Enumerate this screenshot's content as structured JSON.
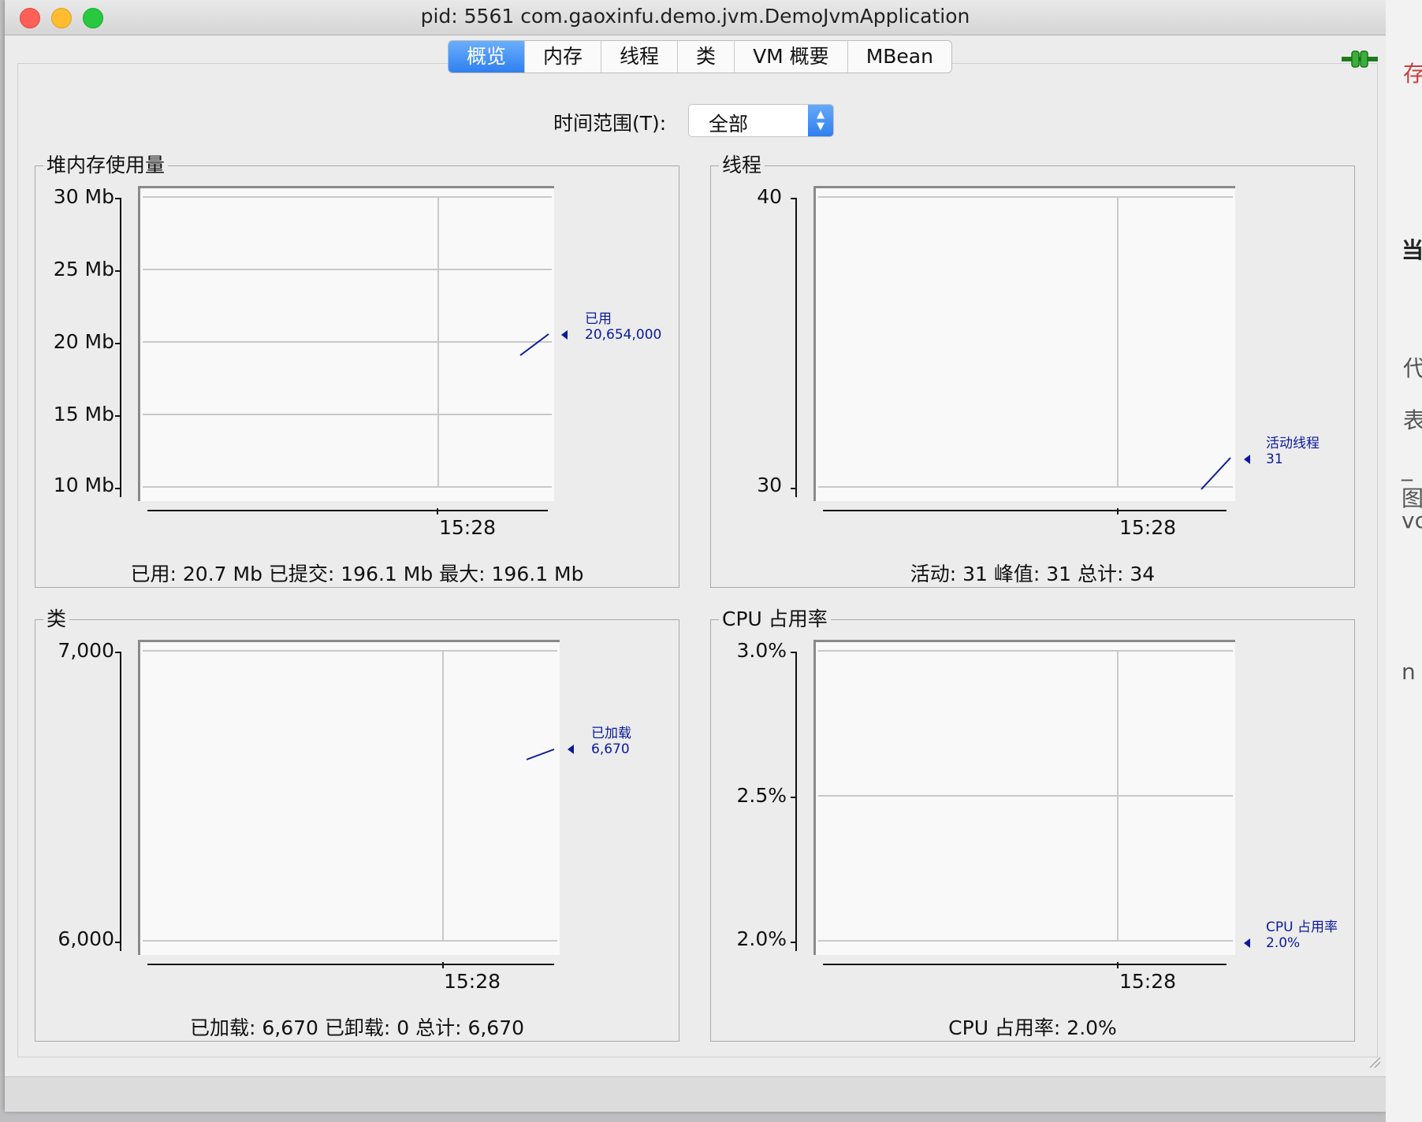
{
  "window": {
    "title": "pid: 5561 com.gaoxinfu.demo.jvm.DemoJvmApplication"
  },
  "tabs": [
    "概览",
    "内存",
    "线程",
    "类",
    "VM 概要",
    "MBean"
  ],
  "time_range": {
    "label": "时间范围(T):",
    "value": "全部"
  },
  "panels": {
    "heap": {
      "title": "堆内存使用量",
      "y_ticks": [
        "30 Mb",
        "25 Mb",
        "20 Mb",
        "15 Mb",
        "10 Mb"
      ],
      "x_label": "15:28",
      "legend_name": "已用",
      "legend_value": "20,654,000",
      "stats": "已用: 20.7 Mb    已提交: 196.1 Mb    最大: 196.1 Mb"
    },
    "threads": {
      "title": "线程",
      "y_ticks": [
        "40",
        "30"
      ],
      "x_label": "15:28",
      "legend_name": "活动线程",
      "legend_value": "31",
      "stats": "活动: 31    峰值: 31    总计: 34"
    },
    "classes": {
      "title": "类",
      "y_ticks": [
        "7,000",
        "6,000"
      ],
      "x_label": "15:28",
      "legend_name": "已加载",
      "legend_value": "6,670",
      "stats": "已加载: 6,670    已卸载: 0    总计: 6,670"
    },
    "cpu": {
      "title": "CPU 占用率",
      "y_ticks": [
        "3.0%",
        "2.5%",
        "2.0%"
      ],
      "x_label": "15:28",
      "legend_name": "CPU 占用率",
      "legend_value": "2.0%",
      "stats": "CPU 占用率: 2.0%"
    }
  },
  "side_fragments": [
    "存",
    "当",
    "代",
    "表",
    "_图",
    "vc",
    "n"
  ],
  "colors": {
    "series": "#0a1a9c",
    "tab_active": "#2f80f0",
    "close": "#fe5f57",
    "minimize": "#febc2e",
    "zoom": "#28c840"
  }
}
